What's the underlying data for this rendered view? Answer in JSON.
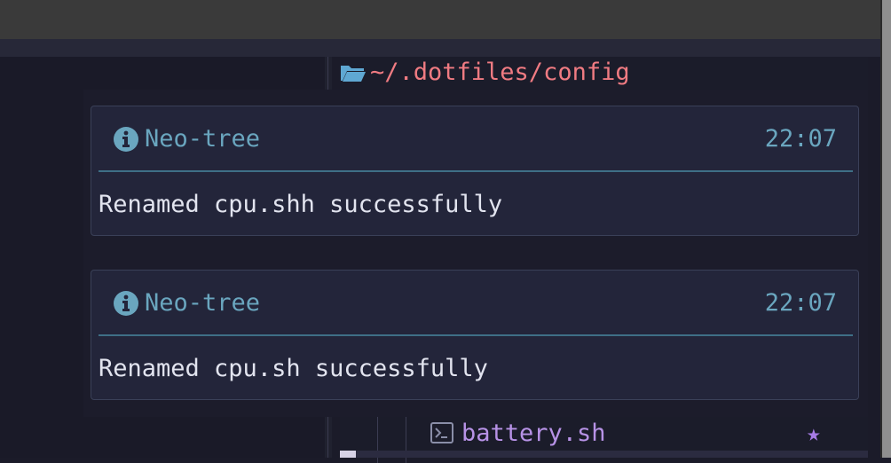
{
  "tree": {
    "path": "~/.dotfiles/config",
    "visible_file": "battery.sh",
    "file_marker": "★"
  },
  "notifications": [
    {
      "source": "Neo-tree",
      "time": "22:07",
      "message": "Renamed cpu.shh successfully",
      "icon": "info-icon"
    },
    {
      "source": "Neo-tree",
      "time": "22:07",
      "message": "Renamed cpu.sh successfully",
      "icon": "info-icon"
    }
  ],
  "colors": {
    "accent_info": "#6aa6bf",
    "path_color": "#f07b82",
    "filename_color": "#b792e6"
  }
}
